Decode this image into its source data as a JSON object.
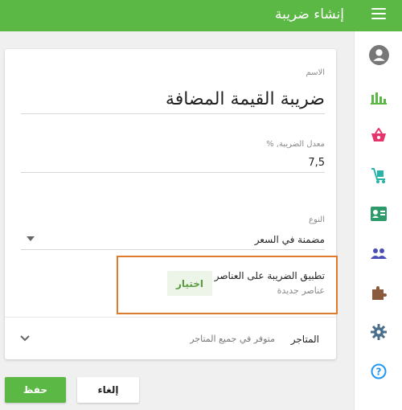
{
  "header": {
    "title": "إنشاء ضريبة"
  },
  "form": {
    "name_label": "الاسم",
    "name_value": "ضريبة القيمة المضافة",
    "rate_label": "معدل الضريبة, %",
    "rate_value": "7,5",
    "type_label": "النوع",
    "type_value": "مضمنة في السعر",
    "apply_title": "تطبيق الضريبة على العناصر",
    "apply_sub": "عناصر جديدة",
    "pick_label": "اختيار",
    "stores_label": "المتاجر",
    "stores_value": "متوفر في جميع المتاجر"
  },
  "actions": {
    "save_label": "حفظ",
    "cancel_label": "إلغاء"
  },
  "sidebar": {
    "items": [
      {
        "icon": "user-icon"
      },
      {
        "icon": "chart-icon"
      },
      {
        "icon": "basket-icon"
      },
      {
        "icon": "cart-icon"
      },
      {
        "icon": "id-card-icon"
      },
      {
        "icon": "users-icon"
      },
      {
        "icon": "puzzle-icon"
      },
      {
        "icon": "gear-icon"
      },
      {
        "icon": "help-icon"
      }
    ]
  },
  "colors": {
    "primary": "#5cb845",
    "highlight": "#e07b2e"
  }
}
